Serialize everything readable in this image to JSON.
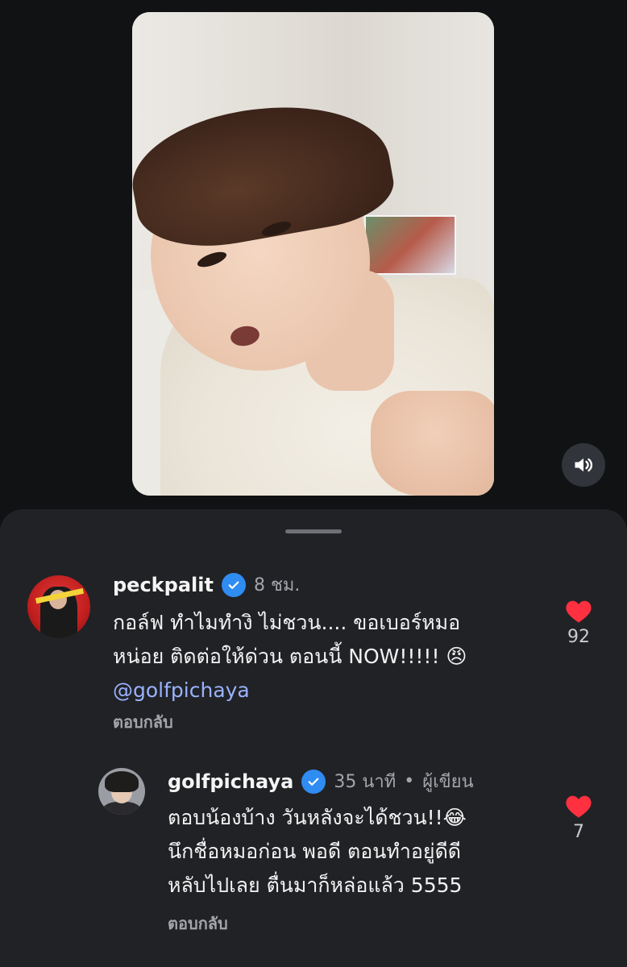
{
  "video": {
    "sound_icon": "speaker-icon"
  },
  "comments": [
    {
      "username": "peckpalit",
      "time": "8 ชม.",
      "lines": [
        "กอล์ฟ ทำไมทำงิ ไม่ชวน.... ขอเบอร์หมอ",
        "หน่อย ติดต่อให้ด่วน ตอนนี้ NOW!!!!! 😠"
      ],
      "mention": "@golfpichaya",
      "reply": "ตอบกลับ",
      "likes": "92"
    },
    {
      "username": "golfpichaya",
      "time": "35 นาที",
      "badge": "ผู้เขียน",
      "separator": "•",
      "lines": [
        "ตอบน้องบ้าง วันหลังจะได้ชวน!!😂",
        "นึกชื่อหมอก่อน พอดี ตอนทำอยู่ดีดี",
        "หลับไปเลย ตื่นมาก็หล่อแล้ว 5555"
      ],
      "reply": "ตอบกลับ",
      "likes": "7"
    }
  ],
  "colors": {
    "accent_like": "#ff3040",
    "verified": "#2f8cf2",
    "mention": "#9ab2ff",
    "sheet_bg": "#212226"
  }
}
